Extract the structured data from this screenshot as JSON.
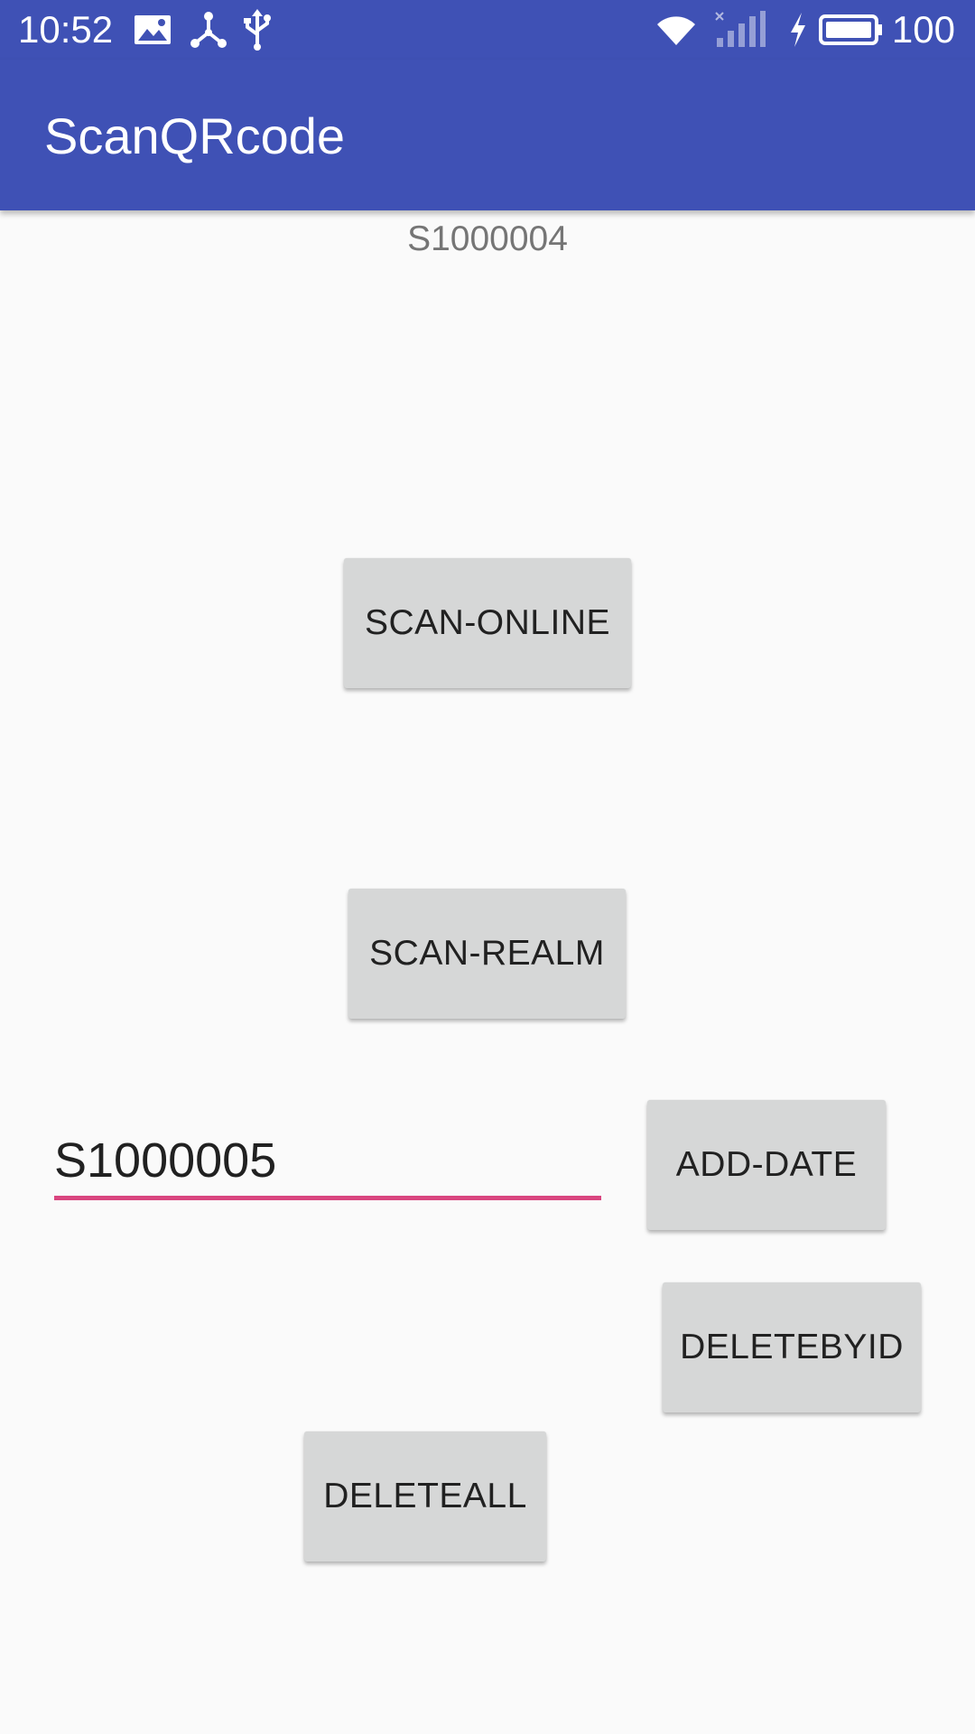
{
  "status_bar": {
    "time": "10:52",
    "battery_level": "100",
    "left_icons": [
      "image-icon",
      "share-icon",
      "usb-icon"
    ],
    "right_icons": [
      "wifi-icon",
      "cell-signal-off-icon",
      "charging-icon",
      "battery-icon"
    ]
  },
  "app_bar": {
    "title": "ScanQRcode",
    "background_color": "#3f51b5"
  },
  "content": {
    "scan_result_text": "S1000004",
    "buttons": {
      "scan_online": "SCAN-ONLINE",
      "scan_realm": "SCAN-REALM",
      "add_date": "ADD-DATE",
      "delete_by_id": "DELETEBYID",
      "delete_all": "DELETEALL"
    },
    "id_input": {
      "value": "S1000005",
      "underline_color": "#d9457f"
    }
  }
}
